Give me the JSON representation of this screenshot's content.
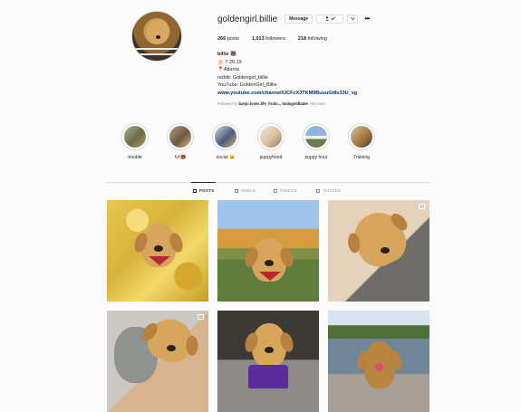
{
  "profile": {
    "username": "goldengirl.billie",
    "message_label": "Message",
    "follow_icon": "person-check-icon",
    "posts_count": "266",
    "posts_label": "posts",
    "followers_count": "1,013",
    "followers_label": "followers",
    "following_count": "218",
    "following_label": "following",
    "name": "billie 🐻",
    "bio_line_1": "🎂 7.26.19",
    "bio_line_2": "📍Atlanta",
    "bio_line_3": "reddit: Goldengirl_billie",
    "bio_line_4": "YouTube: GoldenGirl_Billie",
    "website": "www.youtube.com/channel/UCFcX3TKM9BuuuGt8s33U_vg",
    "followed_by_prefix": "Followed by",
    "followed_by_names": "banjo.loves.life_frodo.., kodagoldbabe",
    "followed_by_more": "+54 more"
  },
  "highlights": [
    {
      "label": "trouble"
    },
    {
      "label": "🐶🐻"
    },
    {
      "label": "social 🐱"
    },
    {
      "label": "puppyhood"
    },
    {
      "label": "puppy hour"
    },
    {
      "label": "Training"
    }
  ],
  "tabs": [
    {
      "label": "POSTS",
      "active": true
    },
    {
      "label": "REELS",
      "active": false
    },
    {
      "label": "VIDEOS",
      "active": false
    },
    {
      "label": "TAGGED",
      "active": false
    }
  ],
  "colors": {
    "background": "#fafafa",
    "text": "#262626",
    "muted": "#8e8e8e",
    "link": "#00376b",
    "border": "#dbdbdb"
  }
}
